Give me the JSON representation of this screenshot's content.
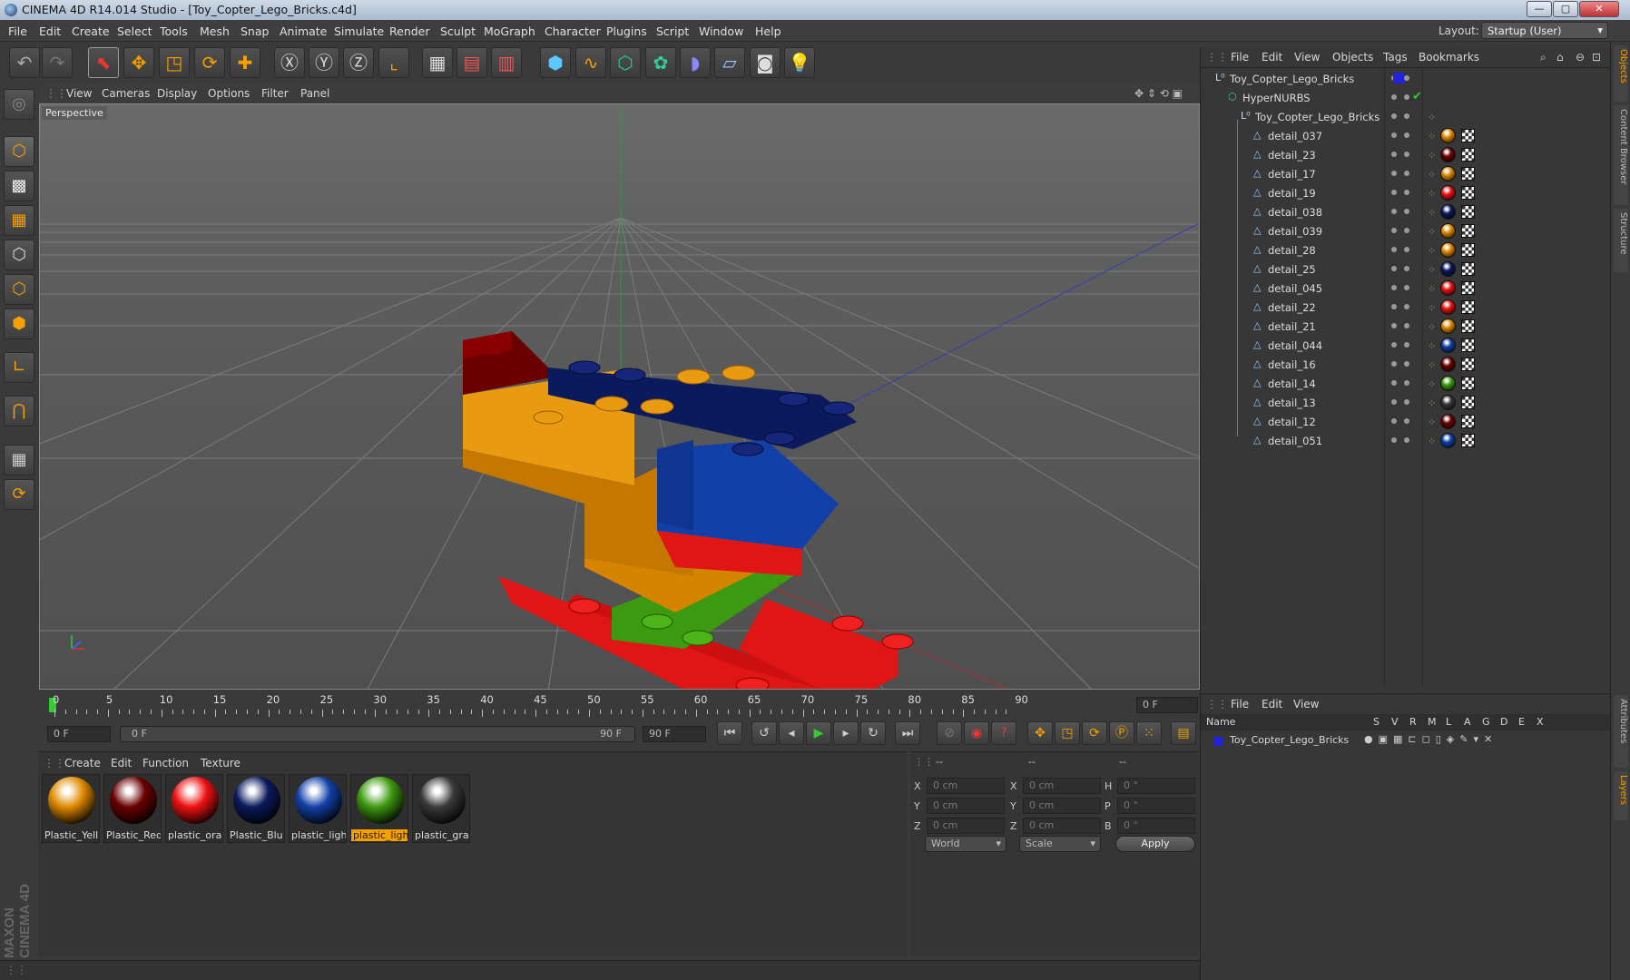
{
  "window": {
    "title": "CINEMA 4D R14.014 Studio - [Toy_Copter_Lego_Bricks.c4d]"
  },
  "menu": [
    "File",
    "Edit",
    "Create",
    "Select",
    "Tools",
    "Mesh",
    "Snap",
    "Animate",
    "Simulate",
    "Render",
    "Sculpt",
    "MoGraph",
    "Character",
    "Plugins",
    "Script",
    "Window",
    "Help"
  ],
  "layout": {
    "label": "Layout:",
    "value": "Startup (User)"
  },
  "toolbar_icons": [
    "undo-icon",
    "redo-icon",
    "live-select-icon",
    "move-icon",
    "scale-icon",
    "rotate-icon",
    "add-icon",
    "x-axis-icon",
    "y-axis-icon",
    "z-axis-icon",
    "world-coords-icon",
    "render-view-icon",
    "render-picture-icon",
    "render-settings-icon",
    "cube-icon",
    "spline-pen-icon",
    "subdivision-icon",
    "array-icon",
    "deformer-icon",
    "floor-icon",
    "camera-icon",
    "light-icon"
  ],
  "viewport": {
    "menu": [
      "View",
      "Cameras",
      "Display",
      "Options",
      "Filter",
      "Panel"
    ],
    "label": "Perspective"
  },
  "timeline": {
    "ticks": [
      "0",
      "5",
      "10",
      "15",
      "20",
      "25",
      "30",
      "35",
      "40",
      "45",
      "50",
      "55",
      "60",
      "65",
      "70",
      "75",
      "80",
      "85",
      "90"
    ],
    "current_frame": "0 F",
    "start": "0 F",
    "slider_left": "0 F",
    "slider_right": "90 F",
    "end": "90 F"
  },
  "materials": {
    "menu": [
      "Create",
      "Edit",
      "Function",
      "Texture"
    ],
    "items": [
      {
        "name": "Plastic_Yell",
        "color": "#e08a00"
      },
      {
        "name": "Plastic_Red",
        "color": "#6a0000"
      },
      {
        "name": "plastic_ora",
        "color": "#ee1111"
      },
      {
        "name": "Plastic_Blu",
        "color": "#0b1a5c"
      },
      {
        "name": "plastic_ligh",
        "color": "#1240a8"
      },
      {
        "name": "plastic_ligh",
        "color": "#3d9a10"
      },
      {
        "name": "plastic_gra",
        "color": "#3a3a3a"
      }
    ],
    "selected_index": 5
  },
  "coords": {
    "header": [
      "--",
      "--",
      "--"
    ],
    "rows": [
      {
        "a": "X",
        "av": "0 cm",
        "b": "X",
        "bv": "0 cm",
        "c": "H",
        "cv": "0 °"
      },
      {
        "a": "Y",
        "av": "0 cm",
        "b": "Y",
        "bv": "0 cm",
        "c": "P",
        "cv": "0 °"
      },
      {
        "a": "Z",
        "av": "0 cm",
        "b": "Z",
        "bv": "0 cm",
        "c": "B",
        "cv": "0 °"
      }
    ],
    "space": "World",
    "mode": "Scale",
    "apply": "Apply"
  },
  "object_manager": {
    "menu": [
      "File",
      "Edit",
      "View",
      "Objects",
      "Tags",
      "Bookmarks"
    ],
    "root": "Toy_Copter_Lego_Bricks",
    "hypernurbs": "HyperNURBS",
    "group": "Toy_Copter_Lego_Bricks",
    "children": [
      {
        "name": "detail_037",
        "mat": "#e08a00"
      },
      {
        "name": "detail_23",
        "mat": "#6a0000"
      },
      {
        "name": "detail_17",
        "mat": "#e08a00"
      },
      {
        "name": "detail_19",
        "mat": "#ee1111"
      },
      {
        "name": "detail_038",
        "mat": "#0b1a5c"
      },
      {
        "name": "detail_039",
        "mat": "#e08a00"
      },
      {
        "name": "detail_28",
        "mat": "#e08a00"
      },
      {
        "name": "detail_25",
        "mat": "#0b1a5c"
      },
      {
        "name": "detail_045",
        "mat": "#ee1111"
      },
      {
        "name": "detail_22",
        "mat": "#ee1111"
      },
      {
        "name": "detail_21",
        "mat": "#e08a00"
      },
      {
        "name": "detail_044",
        "mat": "#1240a8"
      },
      {
        "name": "detail_16",
        "mat": "#6a0000"
      },
      {
        "name": "detail_14",
        "mat": "#3d9a10"
      },
      {
        "name": "detail_13",
        "mat": "#3a3a3a"
      },
      {
        "name": "detail_12",
        "mat": "#6a0000"
      },
      {
        "name": "detail_051",
        "mat": "#1240a8"
      }
    ]
  },
  "layer_manager": {
    "menu": [
      "File",
      "Edit",
      "View"
    ],
    "columns": [
      "Name",
      "S",
      "V",
      "R",
      "M",
      "L",
      "A",
      "G",
      "D",
      "E",
      "X"
    ],
    "row": "Toy_Copter_Lego_Bricks"
  },
  "right_tabs": [
    "Objects",
    "Content Browser",
    "Structure",
    "Attributes",
    "Layers"
  ],
  "branding": "MAXON CINEMA 4D"
}
